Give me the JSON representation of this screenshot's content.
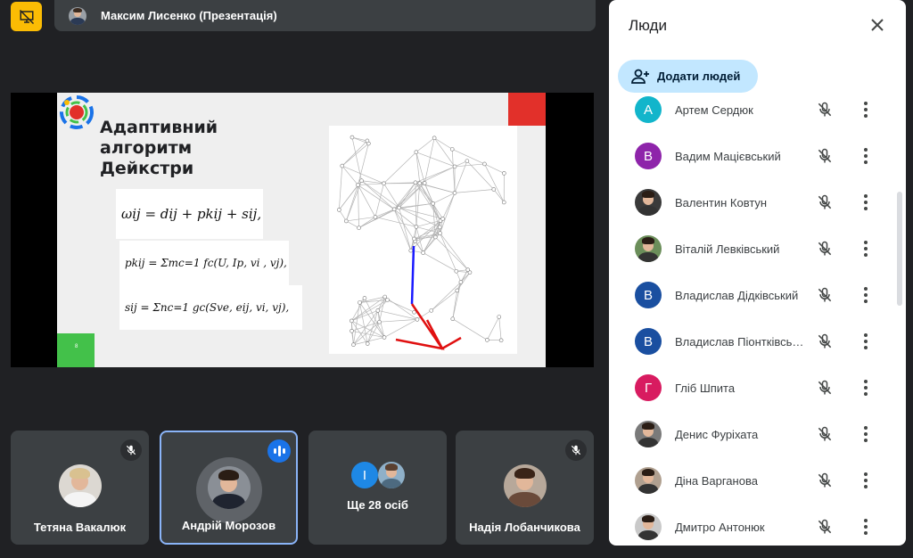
{
  "topbar": {
    "presenter_name": "Максим Лисенко (Презентація)"
  },
  "slide": {
    "title_line1": "Адаптивний",
    "title_line2": "алгоритм",
    "title_line3": "Дейкстри",
    "page_number": "8",
    "formula1": "ωij = dij + pkij + sij,",
    "formula2": "pkij = Σmc=1 fc(U, Ip, vi , vj),",
    "formula3": "sij = Σnc=1 gc(Sve, eij, vi, vj),"
  },
  "tiles": [
    {
      "name": "Тетяна Вакалюк",
      "muted": true
    },
    {
      "name": "Андрій Морозов",
      "speaking": true
    },
    {
      "name": "Ще 28 осіб",
      "initial": "І"
    },
    {
      "name": "Надія Лобанчикова",
      "muted": true
    }
  ],
  "panel": {
    "title": "Люди",
    "add_label": "Додати людей",
    "people": [
      {
        "name": "Артем Сердюк",
        "initial": "А",
        "color": "#12b5cb"
      },
      {
        "name": "Вадим Мацієвський",
        "initial": "В",
        "color": "#8e24aa"
      },
      {
        "name": "Валентин Ковтун",
        "initial": "",
        "color": "#3a3a3a"
      },
      {
        "name": "Віталій Левківський",
        "initial": "",
        "color": "#6b8e5a"
      },
      {
        "name": "Владислав Дідківський",
        "initial": "В",
        "color": "#1a4fa0"
      },
      {
        "name": "Владислав Піонтківський",
        "initial": "В",
        "color": "#1a4fa0"
      },
      {
        "name": "Гліб Шпита",
        "initial": "Г",
        "color": "#d81b60"
      },
      {
        "name": "Денис Фуріхата",
        "initial": "",
        "color": "#7a7a7a"
      },
      {
        "name": "Діна Варганова",
        "initial": "",
        "color": "#b0a090"
      },
      {
        "name": "Дмитро Антонюк",
        "initial": "",
        "color": "#c9c9c9"
      }
    ]
  },
  "colors": {
    "accent": "#1a73e8",
    "background": "#202124",
    "tile": "#3c4043",
    "presenting_badge": "#fbbc04"
  }
}
